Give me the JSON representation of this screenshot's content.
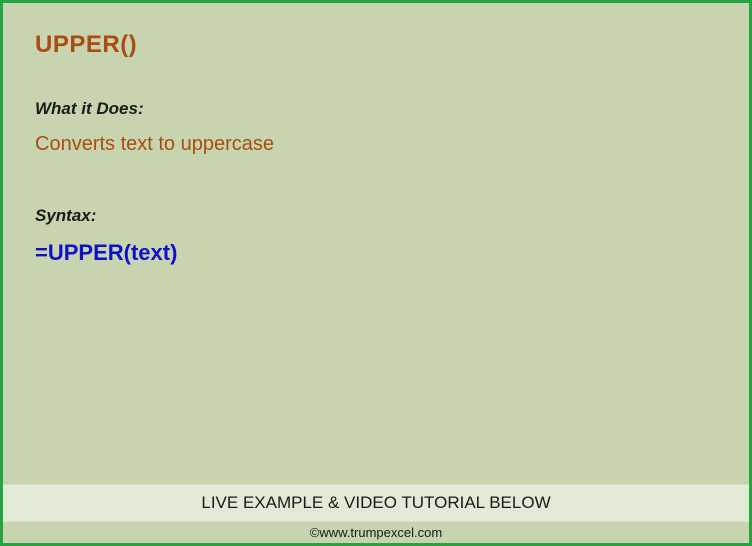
{
  "title": "UPPER()",
  "sections": {
    "what_it_does": {
      "label": "What it Does:",
      "text": "Converts text to uppercase"
    },
    "syntax": {
      "label": "Syntax:",
      "text": "=UPPER(text)"
    }
  },
  "footer": {
    "cta": "LIVE EXAMPLE & VIDEO TUTORIAL BELOW",
    "copyright": "©www.trumpexcel.com"
  }
}
